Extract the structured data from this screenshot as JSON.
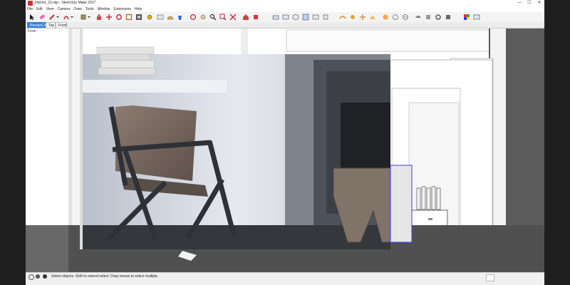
{
  "window": {
    "title": "Interior_15.skp - SketchUp Make 2017",
    "controls": {
      "minimize": "—",
      "maximize": "☐",
      "close": "✕"
    }
  },
  "menu": [
    "File",
    "Edit",
    "View",
    "Camera",
    "Draw",
    "Tools",
    "Window",
    "Extensions",
    "Help"
  ],
  "scene_tabs": [
    {
      "label": "RenderCam",
      "active": true
    },
    {
      "label": "Top",
      "active": false
    },
    {
      "label": "Front",
      "active": false
    }
  ],
  "viewport": {
    "scene_label": "Front"
  },
  "status": {
    "text": "Select objects. Shift to extend select. Drag mouse to select multiple."
  },
  "colors": {
    "tab_active": "#2f7fd6",
    "app_icon": "#c8342b",
    "selection": "#3b3bff"
  },
  "toolbar_icons": [
    "select-icon",
    "eraser-icon",
    "pencil-icon",
    "dropdown-icon",
    "arc-icon",
    "dropdown-icon",
    "shape-icon",
    "dropdown-icon",
    "push-pull-icon",
    "move-icon",
    "rotate-icon",
    "scale-icon",
    "offset-icon",
    "tape-measure-icon",
    "text-icon",
    "protractor-icon",
    "paint-bucket-icon",
    "orbit-icon",
    "pan-icon",
    "zoom-icon",
    "zoom-window-icon",
    "zoom-extents-icon",
    "warehouse-icon",
    "extension-icon",
    "style-icon",
    "layer-icon"
  ]
}
